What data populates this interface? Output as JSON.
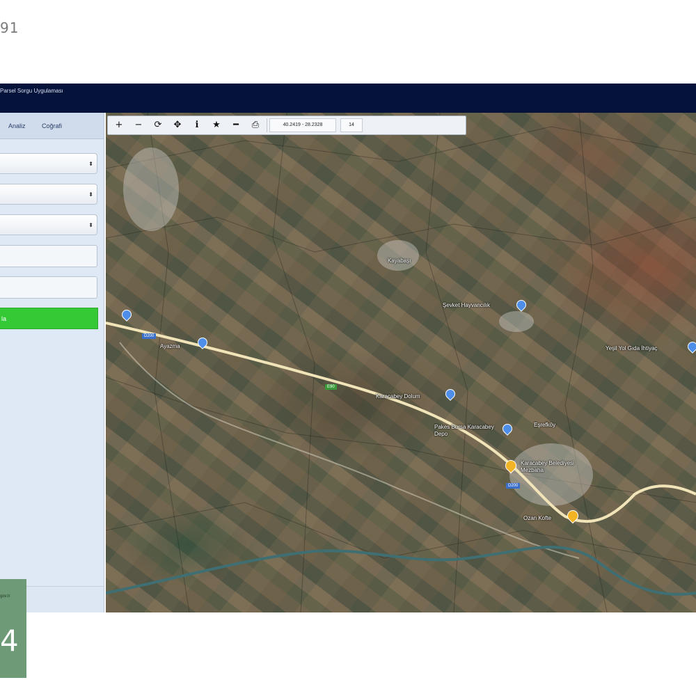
{
  "page": {
    "number": "91"
  },
  "header": {
    "title": "Parsel Sorgu Uygulaması"
  },
  "sidebar": {
    "tabs": [
      {
        "label": "Analiz"
      },
      {
        "label": "Coğrafi"
      }
    ],
    "selects": [
      {
        "arrow": "⬍"
      },
      {
        "arrow": "⬍"
      },
      {
        "arrow": "⬍"
      }
    ],
    "action_button": {
      "label": "la"
    }
  },
  "map": {
    "toolbar": {
      "zoom_in": "+",
      "zoom_out": "−",
      "refresh": "⟳",
      "locate": "✥",
      "info": "ℹ",
      "favorite": "★",
      "measure": "━",
      "print": "⎙",
      "coordinates": "40.2419 - 28.2328",
      "zoom_level": "14"
    },
    "labels": [
      {
        "text": "Ayazma"
      },
      {
        "text": "Şevket Hayvancılık"
      },
      {
        "text": "Yeşil Yol Gıda İhtiyaç"
      },
      {
        "text": "Karacabey Dolum"
      },
      {
        "text": "Pakes Bursa Karacabey Depo"
      },
      {
        "text": "Karacabey Belediyesi Mezbaha"
      },
      {
        "text": "Ozan Kofte"
      },
      {
        "text": "Eşrefköy"
      },
      {
        "text": "Kayabaşı"
      }
    ],
    "shields": [
      {
        "text": "D200"
      },
      {
        "text": "E90"
      },
      {
        "text": "D200"
      }
    ],
    "icons": {
      "blue_pin": "map-pin-blue",
      "yellow_pin": "map-pin-yellow"
    },
    "colors": {
      "road": "#f0e4b8",
      "river": "#3f6f73"
    }
  },
  "badge": {
    "url": "gov.tr",
    "digit": "4"
  }
}
